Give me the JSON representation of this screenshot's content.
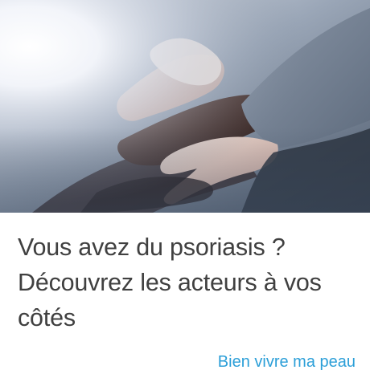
{
  "card": {
    "image": {
      "subject": "stacked-hands-photo"
    },
    "headline": {
      "line1": "Vous avez du psoriasis ?",
      "line2": "Découvrez les acteurs à vos",
      "line3": "côtés"
    },
    "category_link": "Bien vivre ma peau",
    "colors": {
      "headline": "#404040",
      "link": "#2c9fd8",
      "background": "#ffffff"
    }
  }
}
